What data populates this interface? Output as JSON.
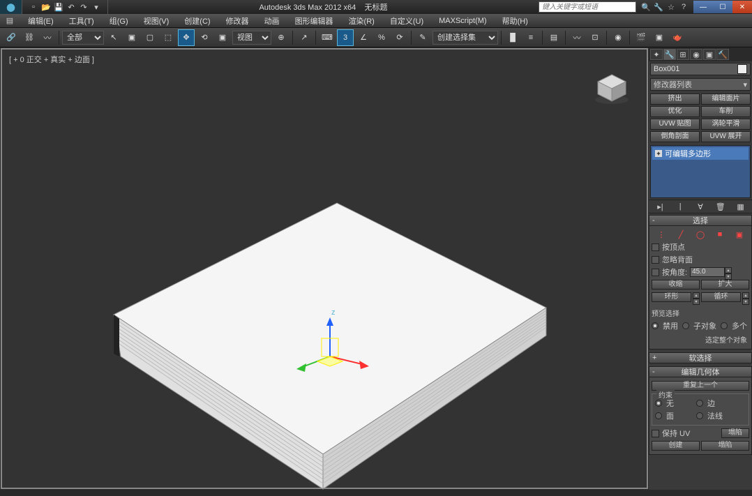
{
  "title": {
    "app_name": "Autodesk 3ds Max  2012  x64",
    "doc_name": "无标题",
    "search_placeholder": "键入关键字或短语"
  },
  "menu": {
    "edit": "编辑(E)",
    "tools": "工具(T)",
    "group": "组(G)",
    "views": "视图(V)",
    "create": "创建(C)",
    "modifiers": "修改器",
    "animation": "动画",
    "graph_editors": "图形编辑器",
    "rendering": "渲染(R)",
    "customize": "自定义(U)",
    "maxscript": "MAXScript(M)",
    "help": "帮助(H)"
  },
  "toolbar": {
    "all_filter": "全部",
    "view_label": "视图",
    "selection_set": "创建选择集",
    "snap_angle": "3"
  },
  "viewport": {
    "label": "[ + 0 正交 + 真实 + 边面  ]"
  },
  "panel": {
    "object_name": "Box001",
    "modifier_list": "修改器列表",
    "mod_buttons": {
      "extrude": "挤出",
      "edit_patch": "编辑面片",
      "optimize": "优化",
      "lathe": "车削",
      "uvw_map": "UVW 贴图",
      "turbosmooth": "涡轮平滑",
      "chamfer": "倒角剖面",
      "uvw_unwrap": "UVW 展开"
    },
    "stack_item": "可编辑多边形"
  },
  "rollouts": {
    "selection": {
      "title": "选择",
      "by_vertex": "按顶点",
      "ignore_backfacing": "忽略背面",
      "by_angle": "按角度:",
      "angle_value": "45.0",
      "shrink": "收缩",
      "grow": "扩大",
      "ring": "环形",
      "loop": "循环",
      "preview_label": "预览选择",
      "disable": "禁用",
      "subobj": "子对象",
      "multi": "多个",
      "select_all": "选定整个对象"
    },
    "soft_selection": {
      "title": "软选择"
    },
    "edit_geometry": {
      "title": "编辑几何体",
      "repeat_last": "重复上一个",
      "constraints": "约束",
      "none": "无",
      "edge": "边",
      "face": "面",
      "normal": "法线",
      "preserve_uv": "保持 UV",
      "settings": "塌陷",
      "create": "创建",
      "collapse": "塌陷"
    }
  }
}
